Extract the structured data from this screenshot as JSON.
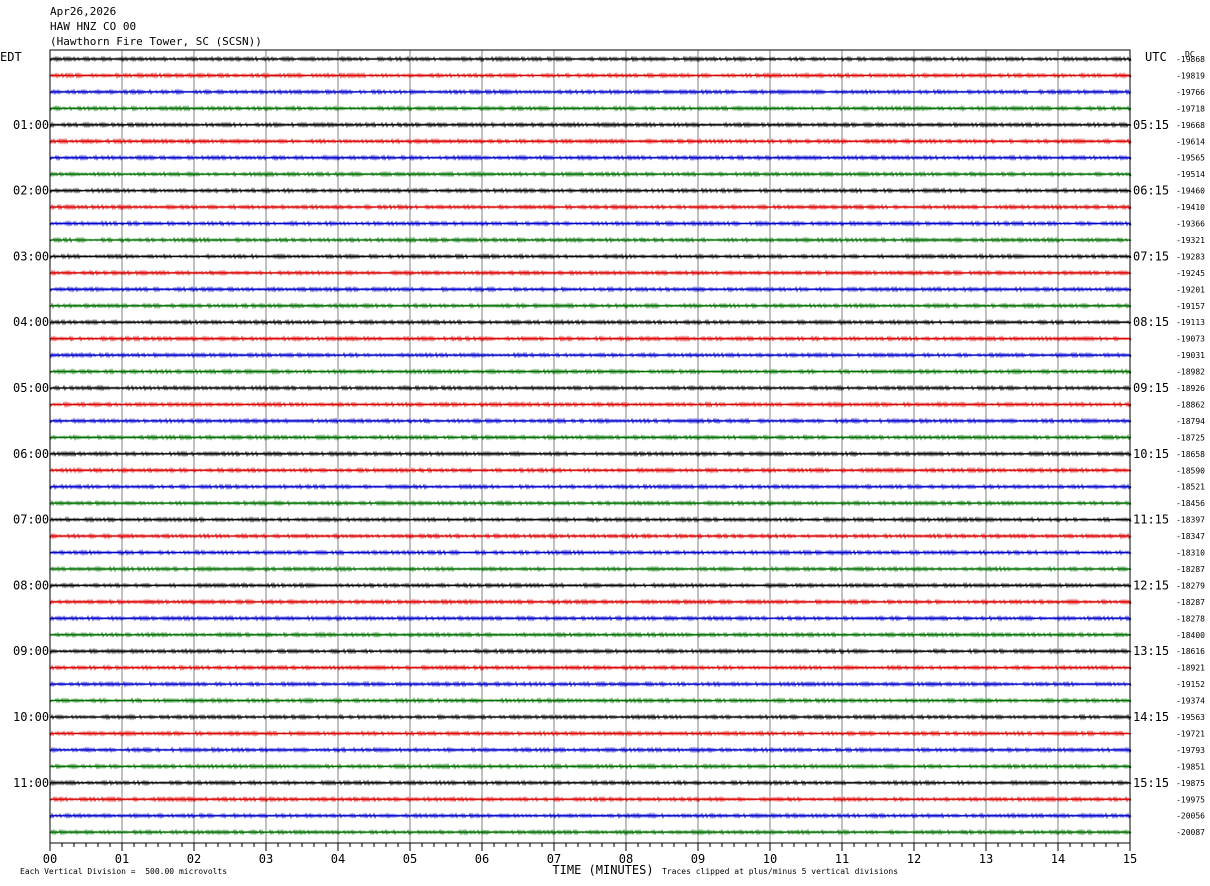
{
  "header": {
    "date": "Apr26,2026",
    "station": "HAW HNZ CO 00",
    "location": "(Hawthorn Fire Tower, SC (SCSN))"
  },
  "chart_data": {
    "type": "line",
    "title": "HAW HNZ CO 00",
    "left_timezone": "EDT",
    "right_timezone": "UTC",
    "right_column_header": "DC",
    "xlabel": "TIME (MINUTES)",
    "x_ticks": [
      "00",
      "01",
      "02",
      "03",
      "04",
      "05",
      "06",
      "07",
      "08",
      "09",
      "10",
      "11",
      "12",
      "13",
      "14",
      "15"
    ],
    "xlim": [
      0,
      15
    ],
    "trace_colors": [
      "#000000",
      "#dd0000",
      "#0000cc",
      "#007000"
    ],
    "left_hour_labels": [
      "01:00",
      "02:00",
      "03:00",
      "04:00",
      "05:00",
      "06:00",
      "07:00",
      "08:00",
      "09:00",
      "10:00",
      "11:00"
    ],
    "right_hour_labels": [
      "05:15",
      "06:15",
      "07:15",
      "08:15",
      "09:15",
      "10:15",
      "11:15",
      "12:15",
      "13:15",
      "14:15",
      "15:15"
    ],
    "dc_offsets": [
      -19868,
      -19819,
      -19766,
      -19718,
      -19668,
      -19614,
      -19565,
      -19514,
      -19460,
      -19410,
      -19366,
      -19321,
      -19283,
      -19245,
      -19201,
      -19157,
      -19113,
      -19073,
      -19031,
      -18982,
      -18926,
      -18862,
      -18794,
      -18725,
      -18658,
      -18590,
      -18521,
      -18456,
      -18397,
      -18347,
      -18310,
      -18287,
      -18279,
      -18287,
      -18278,
      -18400,
      -18616,
      -18921,
      -19152,
      -19374,
      -19563,
      -19721,
      -19793,
      -19851,
      -19875,
      -19975,
      -20056,
      -20087
    ],
    "footer_left": "Each Vertical Division =  500.00 microvolts",
    "footer_right": "Traces clipped at plus/minus 5 vertical divisions"
  }
}
